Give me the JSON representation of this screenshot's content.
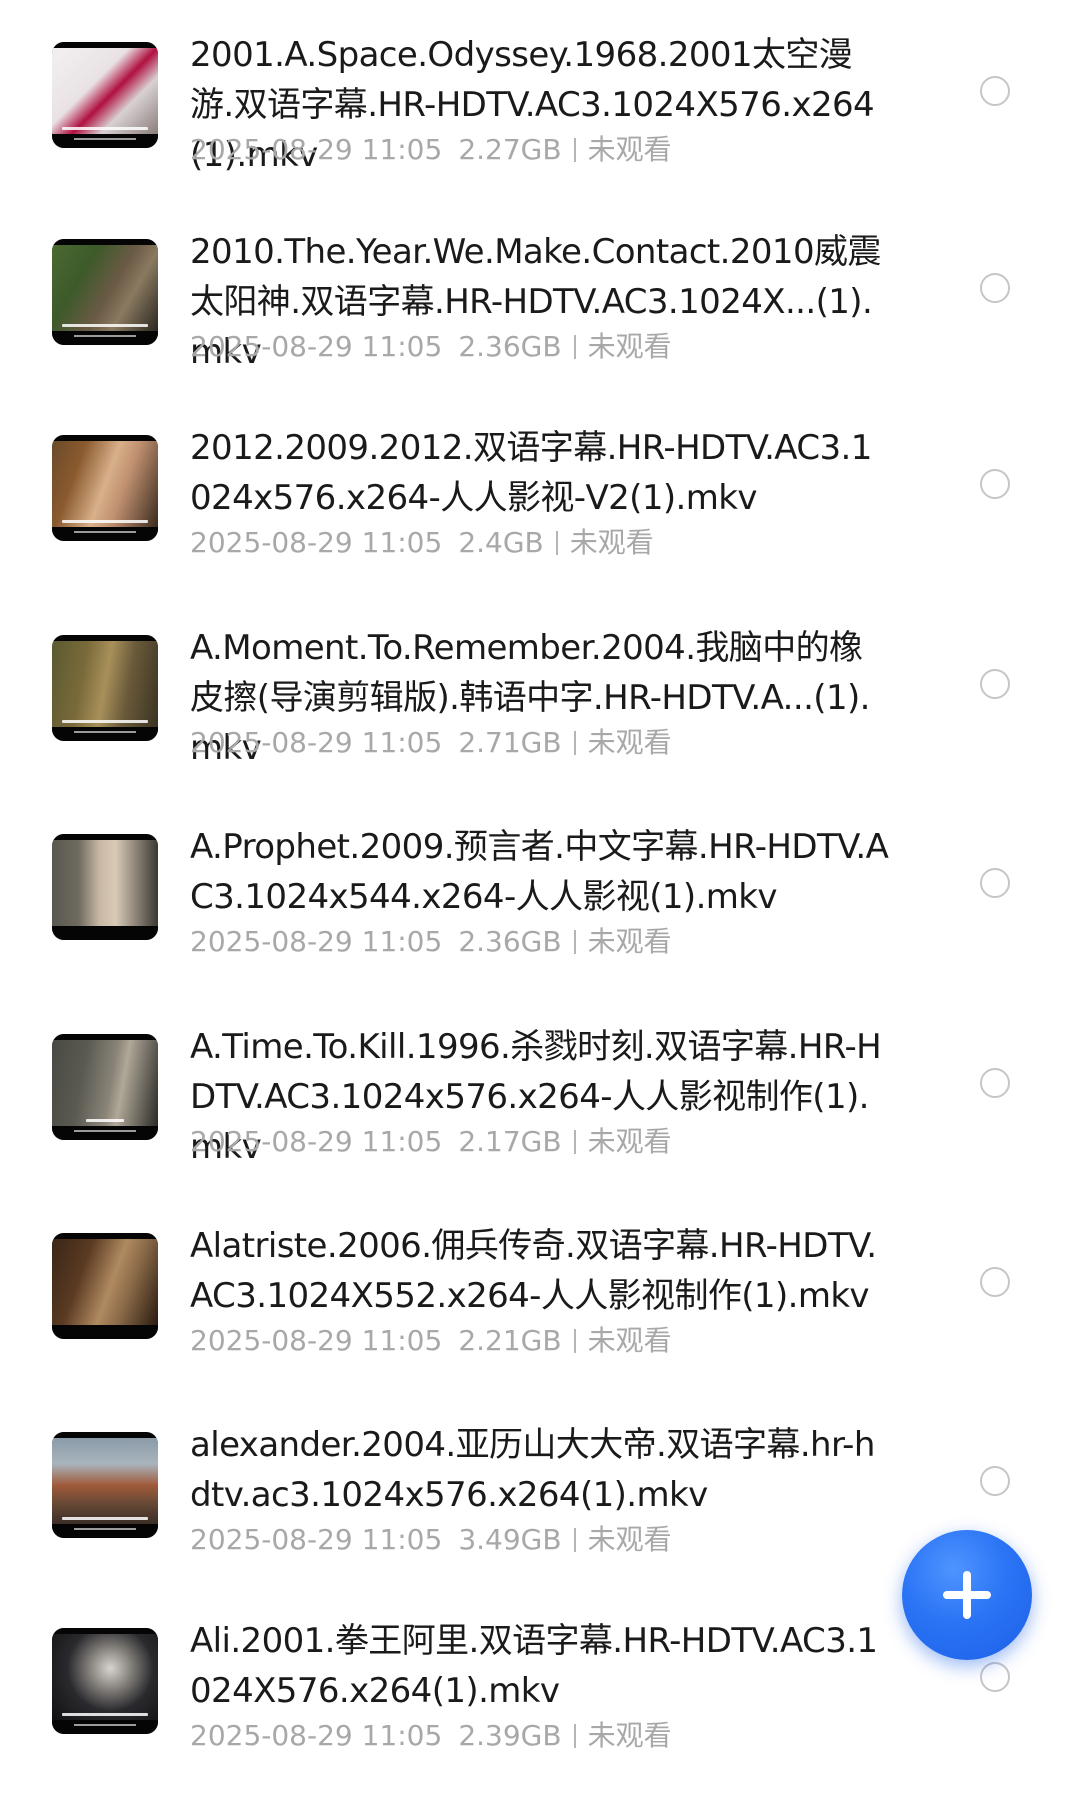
{
  "files": [
    {
      "name": "2001.A.Space.Odyssey.1968.2001太空漫游.双语字幕.HR-HDTV.AC3.1024X576.x264(1).mkv",
      "date": "2025-08-29 11:05",
      "size": "2.27GB",
      "status": "未观看",
      "thumb_icon": "video-thumbnail",
      "thumb_colors": [
        "#f2eef0",
        "#c0104a",
        "#8a7d7a"
      ]
    },
    {
      "name": "2010.The.Year.We.Make.Contact.2010威震太阳神.双语字幕.HR-HDTV.AC3.1024X...(1).mkv",
      "date": "2025-08-29 11:05",
      "size": "2.36GB",
      "status": "未观看",
      "thumb_icon": "video-thumbnail",
      "thumb_colors": [
        "#3d5a2a",
        "#6b5a45",
        "#2a2620"
      ]
    },
    {
      "name": "2012.2009.2012.双语字幕.HR-HDTV.AC3.1024x576.x264-人人影视-V2(1).mkv",
      "date": "2025-08-29 11:05",
      "size": "2.4GB",
      "status": "未观看",
      "thumb_icon": "video-thumbnail",
      "thumb_colors": [
        "#8a5a2e",
        "#d8b08a",
        "#3a2a1e"
      ]
    },
    {
      "name": "A.Moment.To.Remember.2004.我脑中的橡皮擦(导演剪辑版).韩语中字.HR-HDTV.A...(1).mkv",
      "date": "2025-08-29 11:05",
      "size": "2.71GB",
      "status": "未观看",
      "thumb_icon": "video-thumbnail",
      "thumb_colors": [
        "#7a6a3a",
        "#a8905a",
        "#3a3222"
      ]
    },
    {
      "name": "A.Prophet.2009.预言者.中文字幕.HR-HDTV.AC3.1024x544.x264-人人影视(1).mkv",
      "date": "2025-08-29 11:05",
      "size": "2.36GB",
      "status": "未观看",
      "thumb_icon": "video-thumbnail",
      "thumb_colors": [
        "#6e6a60",
        "#c9b9a4",
        "#3a3832"
      ]
    },
    {
      "name": "A.Time.To.Kill.1996.杀戮时刻.双语字幕.HR-HDTV.AC3.1024x576.x264-人人影视制作(1).mkv",
      "date": "2025-08-29 11:05",
      "size": "2.17GB",
      "status": "未观看",
      "thumb_icon": "video-thumbnail",
      "thumb_colors": [
        "#5a5a52",
        "#8a8478",
        "#2a2a26"
      ]
    },
    {
      "name": "Alatriste.2006.佣兵传奇.双语字幕.HR-HDTV.AC3.1024X552.x264-人人影视制作(1).mkv",
      "date": "2025-08-29 11:05",
      "size": "2.21GB",
      "status": "未观看",
      "thumb_icon": "video-thumbnail",
      "thumb_colors": [
        "#5a3a22",
        "#b08a60",
        "#2a1a10"
      ]
    },
    {
      "name": "alexander.2004.亚历山大大帝.双语字幕.hr-hdtv.ac3.1024x576.x264(1).mkv",
      "date": "2025-08-29 11:05",
      "size": "3.49GB",
      "status": "未观看",
      "thumb_icon": "video-thumbnail",
      "thumb_colors": [
        "#8a9aa8",
        "#a05a3a",
        "#3a2e26"
      ]
    },
    {
      "name": "Ali.2001.拳王阿里.双语字幕.HR-HDTV.AC3.1024X576.x264(1).mkv",
      "date": "2025-08-29 11:05",
      "size": "2.39GB",
      "status": "未观看",
      "thumb_icon": "video-thumbnail",
      "thumb_colors": [
        "#2a2a2e",
        "#d8d4d0",
        "#101012"
      ]
    }
  ],
  "fab": {
    "icon": "plus-icon",
    "color": "#2a74f5"
  }
}
